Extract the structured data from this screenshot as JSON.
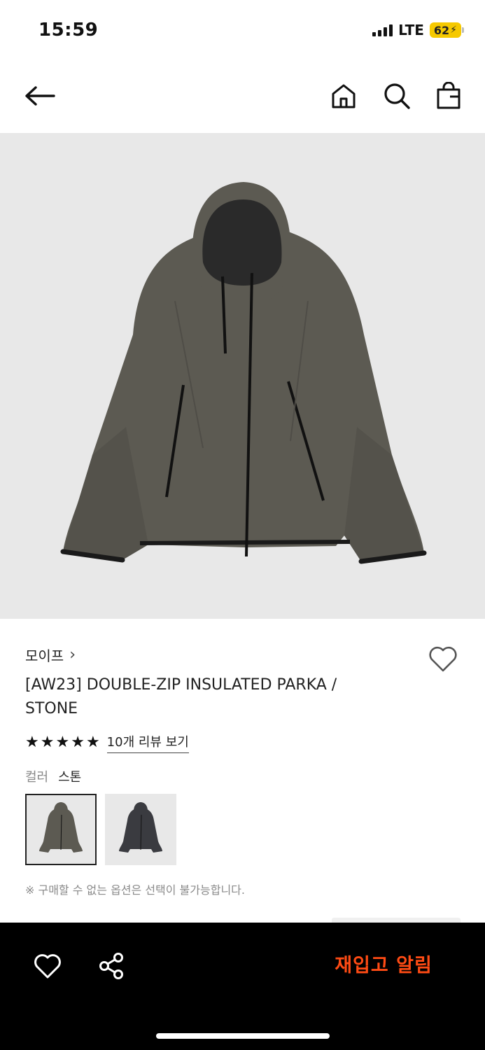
{
  "status_bar": {
    "time": "15:59",
    "network": "LTE",
    "battery": "62"
  },
  "nav": {
    "back_icon": "arrow-left-icon",
    "home_icon": "home-icon",
    "search_icon": "search-icon",
    "bag_icon": "shopping-bag-icon"
  },
  "product": {
    "brand": "모이프",
    "brand_chevron": "›",
    "name": "[AW23] DOUBLE-ZIP INSULATED PARKA / STONE",
    "rating_stars": 5,
    "review_link": "10개 리뷰 보기",
    "color_label": "컬러",
    "color_value": "스톤",
    "swatches": [
      {
        "name": "stone",
        "color": "#5c5a52",
        "selected": true
      },
      {
        "name": "charcoal",
        "color": "#3a3b40",
        "selected": false
      }
    ],
    "notice": "※ 구매할 수 없는 옵션은 선택이 불가능합니다."
  },
  "bottom_bar": {
    "restock_label": "재입고 알림",
    "accent": "#ff4b14"
  },
  "colors": {
    "image_bg": "#e8e8e8",
    "jacket": "#5c5a52",
    "bottom_bar": "#000000"
  }
}
